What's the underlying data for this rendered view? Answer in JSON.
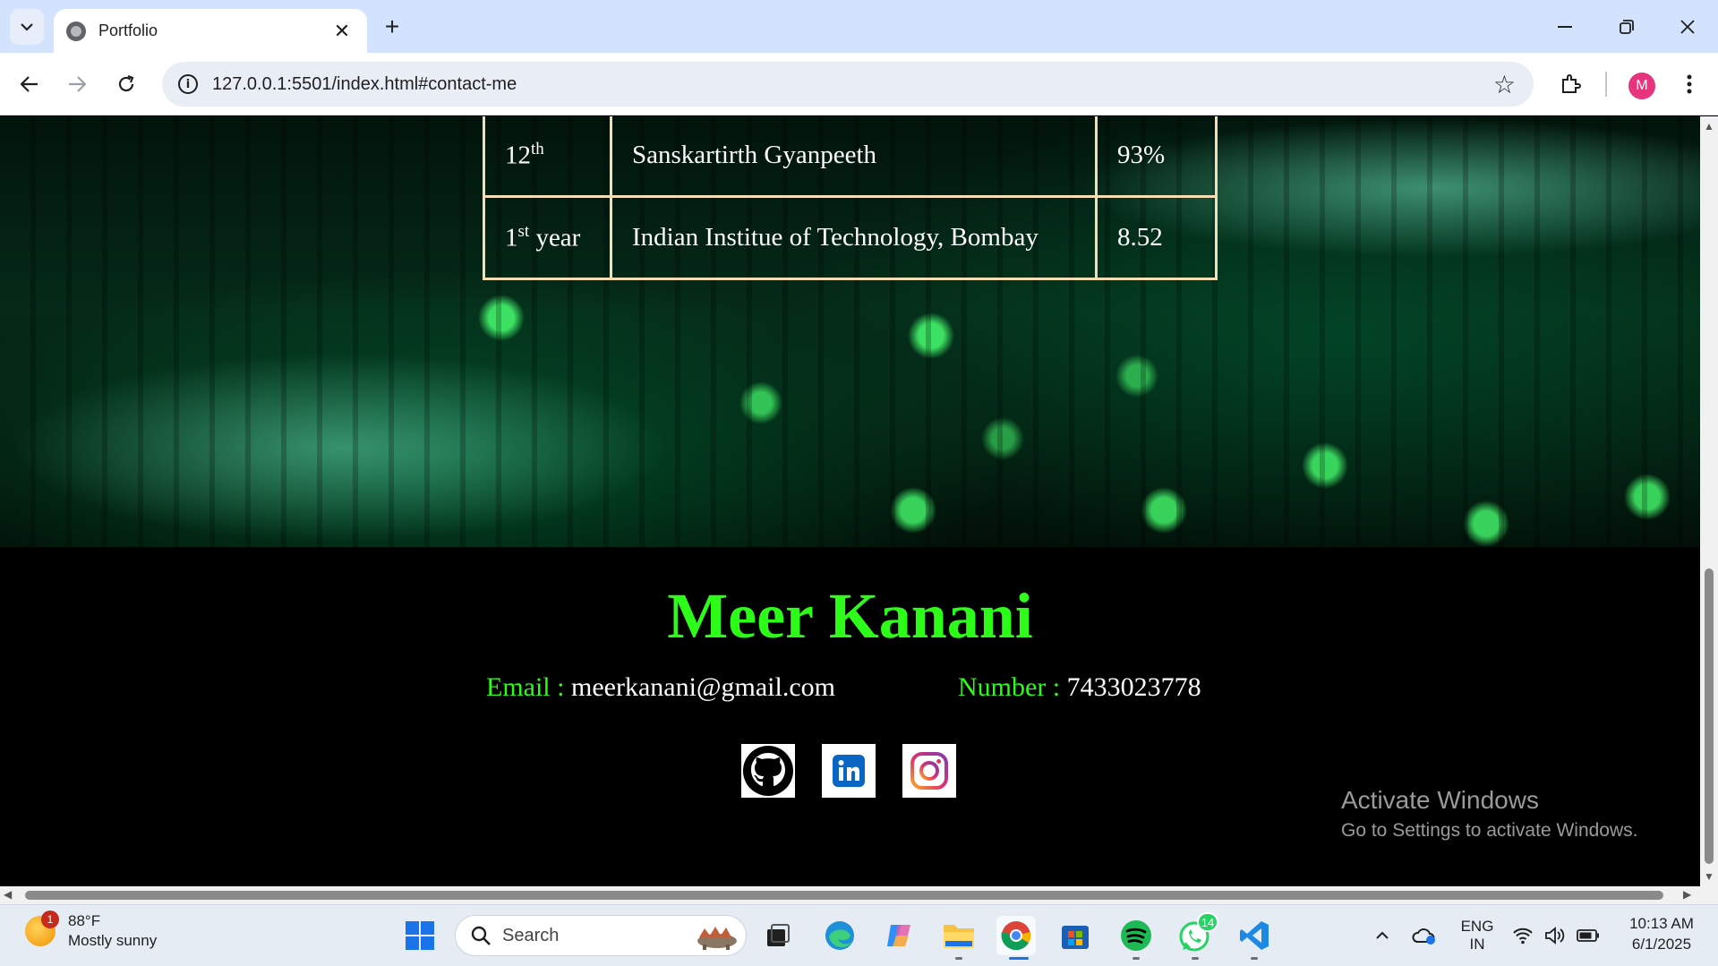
{
  "browser": {
    "tab_title": "Portfolio",
    "url": "127.0.0.1:5501/index.html#contact-me",
    "profile_initial": "M"
  },
  "education": {
    "rows": [
      {
        "level": "12",
        "level_sup": "th",
        "level_suffix": "",
        "institute": "Sanskartirth Gyanpeeth",
        "score": "93%"
      },
      {
        "level": "1",
        "level_sup": "st",
        "level_suffix": " year",
        "institute": "Indian Institue of Technology, Bombay",
        "score": "8.52"
      }
    ]
  },
  "footer": {
    "name": "Meer Kanani",
    "email_label": "Email : ",
    "email": "meerkanani@gmail.com",
    "number_label": "Number : ",
    "number": "7433023778",
    "socials": [
      "github-icon",
      "linkedin-icon",
      "instagram-icon"
    ]
  },
  "watermark": {
    "title": "Activate Windows",
    "subtitle": "Go to Settings to activate Windows."
  },
  "taskbar": {
    "weather_temp": "88°F",
    "weather_desc": "Mostly sunny",
    "weather_badge": "1",
    "search_label": "Search",
    "whatsapp_badge": "14",
    "lang_top": "ENG",
    "lang_bottom": "IN",
    "time": "10:13 AM",
    "date": "6/1/2025"
  },
  "colors": {
    "accent_green": "#2dfc19",
    "table_border": "#f5deb3"
  }
}
